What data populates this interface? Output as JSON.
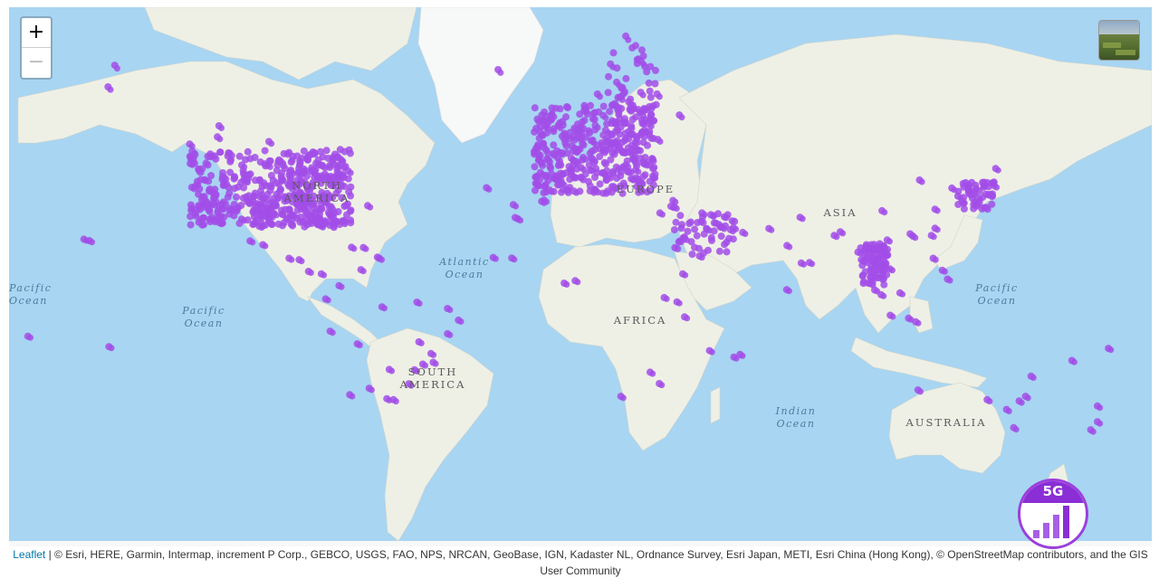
{
  "zoom": {
    "in_label": "+",
    "out_label": "−"
  },
  "labels": {
    "north_america": "NORTH\nAMERICA",
    "south_america": "SOUTH\nAMERICA",
    "europe": "EUROPE",
    "africa": "AFRICA",
    "asia": "ASIA",
    "australia": "AUSTRALIA"
  },
  "oceans": {
    "atlantic": "Atlantic\nOcean",
    "pacific_left": "Pacific\nOcean",
    "pacific_mid": "Pacific\nOcean",
    "pacific_right": "Pacific\nOcean",
    "indian": "Indian\nOcean"
  },
  "badge": {
    "label": "5G"
  },
  "attribution": {
    "link": "Leaflet",
    "text": " | © Esri, HERE, Garmin, Intermap, increment P Corp., GEBCO, USGS, FAO, NPS, NRCAN, GeoBase, IGN, Kadaster NL, Ordnance Survey, Esri Japan, METI, Esri China (Hong Kong), © OpenStreetMap contributors, and the GIS User Community"
  },
  "colors": {
    "marker": "#a24ee8",
    "ocean": "#a8d5f2",
    "land": "#eef0e6",
    "ice": "#f7f8f8"
  },
  "markers": {
    "clusters": [
      [
        -122.4,
        37.8
      ],
      [
        -118.2,
        34
      ],
      [
        -117,
        32.7
      ],
      [
        -122.3,
        47.6
      ],
      [
        -122.7,
        45.5
      ],
      [
        -112,
        33.4
      ],
      [
        -115.1,
        36.2
      ],
      [
        -104.9,
        39.7
      ],
      [
        -111.9,
        40.7
      ],
      [
        -97.7,
        30.3
      ],
      [
        -96.8,
        32.8
      ],
      [
        -95.4,
        29.8
      ],
      [
        -98.5,
        29.4
      ],
      [
        -90.1,
        29.9
      ],
      [
        -84.4,
        33.7
      ],
      [
        -80.2,
        25.8
      ],
      [
        -81.4,
        28.5
      ],
      [
        -82.5,
        27.9
      ],
      [
        -87.6,
        41.9
      ],
      [
        -83,
        42.3
      ],
      [
        -93.3,
        45
      ],
      [
        -90.2,
        38.6
      ],
      [
        -94.6,
        39.1
      ],
      [
        -86.8,
        36.2
      ],
      [
        -74,
        40.7
      ],
      [
        -71.1,
        42.4
      ],
      [
        -77,
        38.9
      ],
      [
        -75.2,
        39.9
      ],
      [
        -80,
        40.4
      ],
      [
        -81.7,
        41.5
      ],
      [
        -79.4,
        43.7
      ],
      [
        -73.6,
        45.5
      ],
      [
        -123.1,
        49.3
      ],
      [
        -114,
        51
      ],
      [
        -113.5,
        53.5
      ],
      [
        -97.1,
        49.9
      ],
      [
        -85,
        35
      ],
      [
        -88,
        33
      ],
      [
        -100,
        35
      ],
      [
        -102,
        31
      ],
      [
        -99.1,
        19.4
      ],
      [
        -103.3,
        20.7
      ],
      [
        -100.3,
        25.7
      ],
      [
        -106,
        28
      ],
      [
        -97.5,
        44
      ],
      [
        -106,
        44
      ],
      [
        -110,
        47
      ],
      [
        -92,
        35
      ],
      [
        -78,
        36
      ],
      [
        -80,
        35
      ],
      [
        -0.1,
        51.5
      ],
      [
        2.35,
        48.9
      ],
      [
        -3.7,
        40.4
      ],
      [
        2.2,
        41.4
      ],
      [
        -9.1,
        38.7
      ],
      [
        12.5,
        41.9
      ],
      [
        9.2,
        45.5
      ],
      [
        14.3,
        40.9
      ],
      [
        13.4,
        52.5
      ],
      [
        10,
        53.6
      ],
      [
        11.6,
        48.1
      ],
      [
        8.7,
        50.1
      ],
      [
        4.9,
        52.4
      ],
      [
        4.4,
        50.9
      ],
      [
        16.4,
        48.2
      ],
      [
        19,
        47.5
      ],
      [
        21,
        52.2
      ],
      [
        14.4,
        50.1
      ],
      [
        26.1,
        44.4
      ],
      [
        23.3,
        42.7
      ],
      [
        23.7,
        38
      ],
      [
        28.9,
        41
      ],
      [
        18.1,
        59.3
      ],
      [
        10.7,
        59.9
      ],
      [
        12.6,
        55.7
      ],
      [
        24.9,
        60.2
      ],
      [
        -6.3,
        53.3
      ],
      [
        -4.3,
        55.9
      ],
      [
        -2.2,
        53.5
      ],
      [
        6,
        46
      ],
      [
        1.4,
        43.6
      ],
      [
        5.4,
        43.3
      ],
      [
        -1.6,
        47.2
      ],
      [
        30.5,
        50.4
      ],
      [
        27.6,
        53.9
      ],
      [
        24.1,
        56.9
      ],
      [
        25.3,
        54.7
      ],
      [
        17,
        62
      ],
      [
        15,
        65
      ],
      [
        25,
        65.5
      ],
      [
        20,
        69
      ],
      [
        -21.9,
        64.1
      ],
      [
        37.6,
        55.8
      ],
      [
        30.3,
        59.9
      ],
      [
        -8,
        42
      ],
      [
        -5,
        37
      ],
      [
        -1,
        39
      ],
      [
        16,
        38
      ],
      [
        20,
        44
      ],
      [
        22,
        49
      ],
      [
        55.3,
        25.2
      ],
      [
        54.4,
        24.5
      ],
      [
        51.5,
        25.3
      ],
      [
        50.6,
        26.2
      ],
      [
        47.9,
        29.4
      ],
      [
        46.7,
        24.7
      ],
      [
        39.2,
        21.5
      ],
      [
        45,
        30
      ],
      [
        35.5,
        33.9
      ],
      [
        35.9,
        31.9
      ],
      [
        34.8,
        32.1
      ],
      [
        58.4,
        23.6
      ],
      [
        44.2,
        15.4
      ],
      [
        100.5,
        13.8
      ],
      [
        102.6,
        17.9
      ],
      [
        105.8,
        21
      ],
      [
        106.7,
        10.8
      ],
      [
        104.9,
        11.6
      ],
      [
        101.7,
        3.1
      ],
      [
        103.8,
        1.35
      ],
      [
        96.2,
        16.8
      ],
      [
        98.9,
        18.8
      ],
      [
        100.3,
        5.4
      ],
      [
        77.2,
        28.6
      ],
      [
        72.9,
        19.1
      ],
      [
        77.6,
        12.9
      ],
      [
        80.3,
        13.1
      ],
      [
        88.4,
        22.6
      ],
      [
        139.7,
        35.7
      ],
      [
        135.5,
        34.7
      ],
      [
        130.4,
        33.6
      ],
      [
        141.4,
        43.1
      ],
      [
        140.9,
        38.3
      ],
      [
        127,
        37.6
      ],
      [
        129,
        35.2
      ],
      [
        121.5,
        25
      ],
      [
        120.3,
        22.6
      ],
      [
        114.2,
        22.3
      ],
      [
        121.5,
        31.2
      ],
      [
        113.3,
        23.1
      ],
      [
        116.4,
        39.9
      ],
      [
        104.1,
        30.7
      ],
      [
        120.9,
        14.6
      ],
      [
        123.9,
        10.3
      ],
      [
        125.6,
        7.1
      ],
      [
        110,
        2
      ],
      [
        106.8,
        -6.2
      ],
      [
        112.8,
        -7.3
      ],
      [
        115.2,
        -8.6
      ],
      [
        151.2,
        -33.9
      ],
      [
        144.96,
        -37.8
      ],
      [
        153,
        -27.5
      ],
      [
        115.9,
        -31.95
      ],
      [
        138.6,
        -34.9
      ],
      [
        149.1,
        -35.3
      ],
      [
        147.3,
        -42.9
      ],
      [
        174.8,
        -36.8
      ],
      [
        174.8,
        -41.3
      ],
      [
        172.6,
        -43.5
      ],
      [
        -46.6,
        -23.5
      ],
      [
        -43.2,
        -22.9
      ],
      [
        -43.9,
        -19.9
      ],
      [
        -49.3,
        -25.4
      ],
      [
        -51.2,
        -30
      ],
      [
        -47.9,
        -15.8
      ],
      [
        -38.5,
        -12.9
      ],
      [
        -34.9,
        -8
      ],
      [
        -38.5,
        -3.7
      ],
      [
        -48.5,
        -1.4
      ],
      [
        -60,
        -3.1
      ],
      [
        -58.4,
        -34.6
      ],
      [
        -64.2,
        -31.4
      ],
      [
        -70.6,
        -33.4
      ],
      [
        -77,
        -12
      ],
      [
        -78.5,
        -0.2
      ],
      [
        -74.1,
        4.7
      ],
      [
        -66.9,
        10.5
      ],
      [
        -56.2,
        -34.9
      ],
      [
        -57.6,
        -25.3
      ],
      [
        28,
        -26.2
      ],
      [
        18.4,
        -33.9
      ],
      [
        31,
        -29.9
      ],
      [
        36.8,
        -1.3
      ],
      [
        39.3,
        -6.8
      ],
      [
        32.6,
        0.3
      ],
      [
        3.4,
        6.5
      ],
      [
        -0.2,
        5.6
      ],
      [
        -17.4,
        14.7
      ],
      [
        -7.6,
        33.6
      ],
      [
        -6.8,
        34
      ],
      [
        3,
        36.7
      ],
      [
        10.2,
        36.8
      ],
      [
        31.2,
        30
      ],
      [
        38.7,
        9
      ],
      [
        47.5,
        -18.9
      ],
      [
        57.5,
        -20.2
      ],
      [
        55.5,
        -21.1
      ],
      [
        -15.4,
        28.1
      ],
      [
        -16.3,
        28.5
      ],
      [
        -157.8,
        21.3
      ],
      [
        -156,
        20.8
      ],
      [
        -149.9,
        61.2
      ],
      [
        -147.7,
        64.8
      ],
      [
        -66.1,
        18.4
      ],
      [
        -64.7,
        32.3
      ],
      [
        -61.5,
        15
      ],
      [
        -60.9,
        14.6
      ],
      [
        -70,
        18.5
      ],
      [
        -79.9,
        9
      ],
      [
        -84.1,
        9.9
      ],
      [
        -90.5,
        14.6
      ],
      [
        -176.2,
        -13.8
      ],
      [
        178.4,
        -18.1
      ],
      [
        166.4,
        -22.3
      ],
      [
        -149.6,
        -17.5
      ],
      [
        -16.9,
        32.6
      ],
      [
        -25.7,
        37.7
      ],
      [
        -23.5,
        14.9
      ],
      [
        72.8,
        3.2
      ],
      [
        67,
        24.9
      ],
      [
        90.4,
        23.8
      ],
      [
        -87.2,
        14.1
      ],
      [
        -68.1,
        -16.5
      ]
    ],
    "dense_regions": [
      {
        "lon": [
          -123,
          -70
        ],
        "lat": [
          26,
          48
        ],
        "count": 420
      },
      {
        "lon": [
          -10,
          30
        ],
        "lat": [
          36,
          58
        ],
        "count": 360
      },
      {
        "lon": [
          97,
          106
        ],
        "lat": [
          5,
          20
        ],
        "count": 80
      },
      {
        "lon": [
          36,
          56
        ],
        "lat": [
          16,
          30
        ],
        "count": 50
      },
      {
        "lon": [
          129,
          141
        ],
        "lat": [
          31,
          40
        ],
        "count": 50
      },
      {
        "lon": [
          14,
          30
        ],
        "lat": [
          56,
          68
        ],
        "count": 40
      },
      {
        "lon": [
          -100,
          -75
        ],
        "lat": [
          25,
          35
        ],
        "count": 60
      }
    ]
  }
}
